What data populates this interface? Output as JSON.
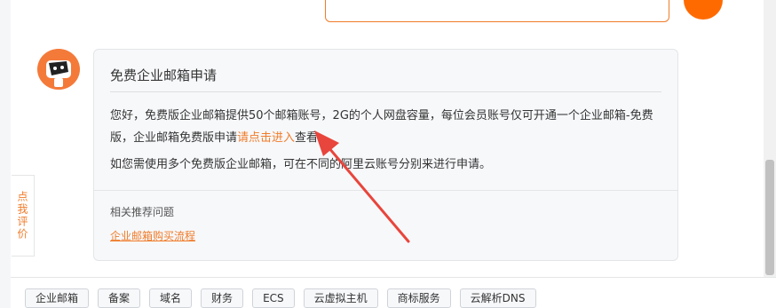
{
  "bot_message": {
    "title": "免费企业邮箱申请",
    "paragraph1_prefix": "您好，免费版企业邮箱提供50个邮箱账号，2G的个人网盘容量，每位会员账号仅可开通一个企业邮箱-免费版，企业邮箱免费版申请",
    "paragraph1_link": "请点击进入",
    "paragraph1_suffix": "查看。",
    "paragraph2": "如您需使用多个免费版企业邮箱，可在不同的阿里云账号分别来进行申请。",
    "related_label": "相关推荐问题",
    "related_link": "企业邮箱购买流程"
  },
  "rate_tab": {
    "label": "点我评价"
  },
  "quick_tags": [
    "企业邮箱",
    "备案",
    "域名",
    "财务",
    "ECS",
    "云虚拟主机",
    "商标服务",
    "云解析DNS"
  ],
  "colors": {
    "accent": "#f07c2a",
    "avatar_bg": "#f47a3a",
    "annotation_arrow": "#e8453c"
  },
  "icons": {
    "bot_avatar": "robot-icon",
    "annotation": "red-arrow-annotation"
  }
}
